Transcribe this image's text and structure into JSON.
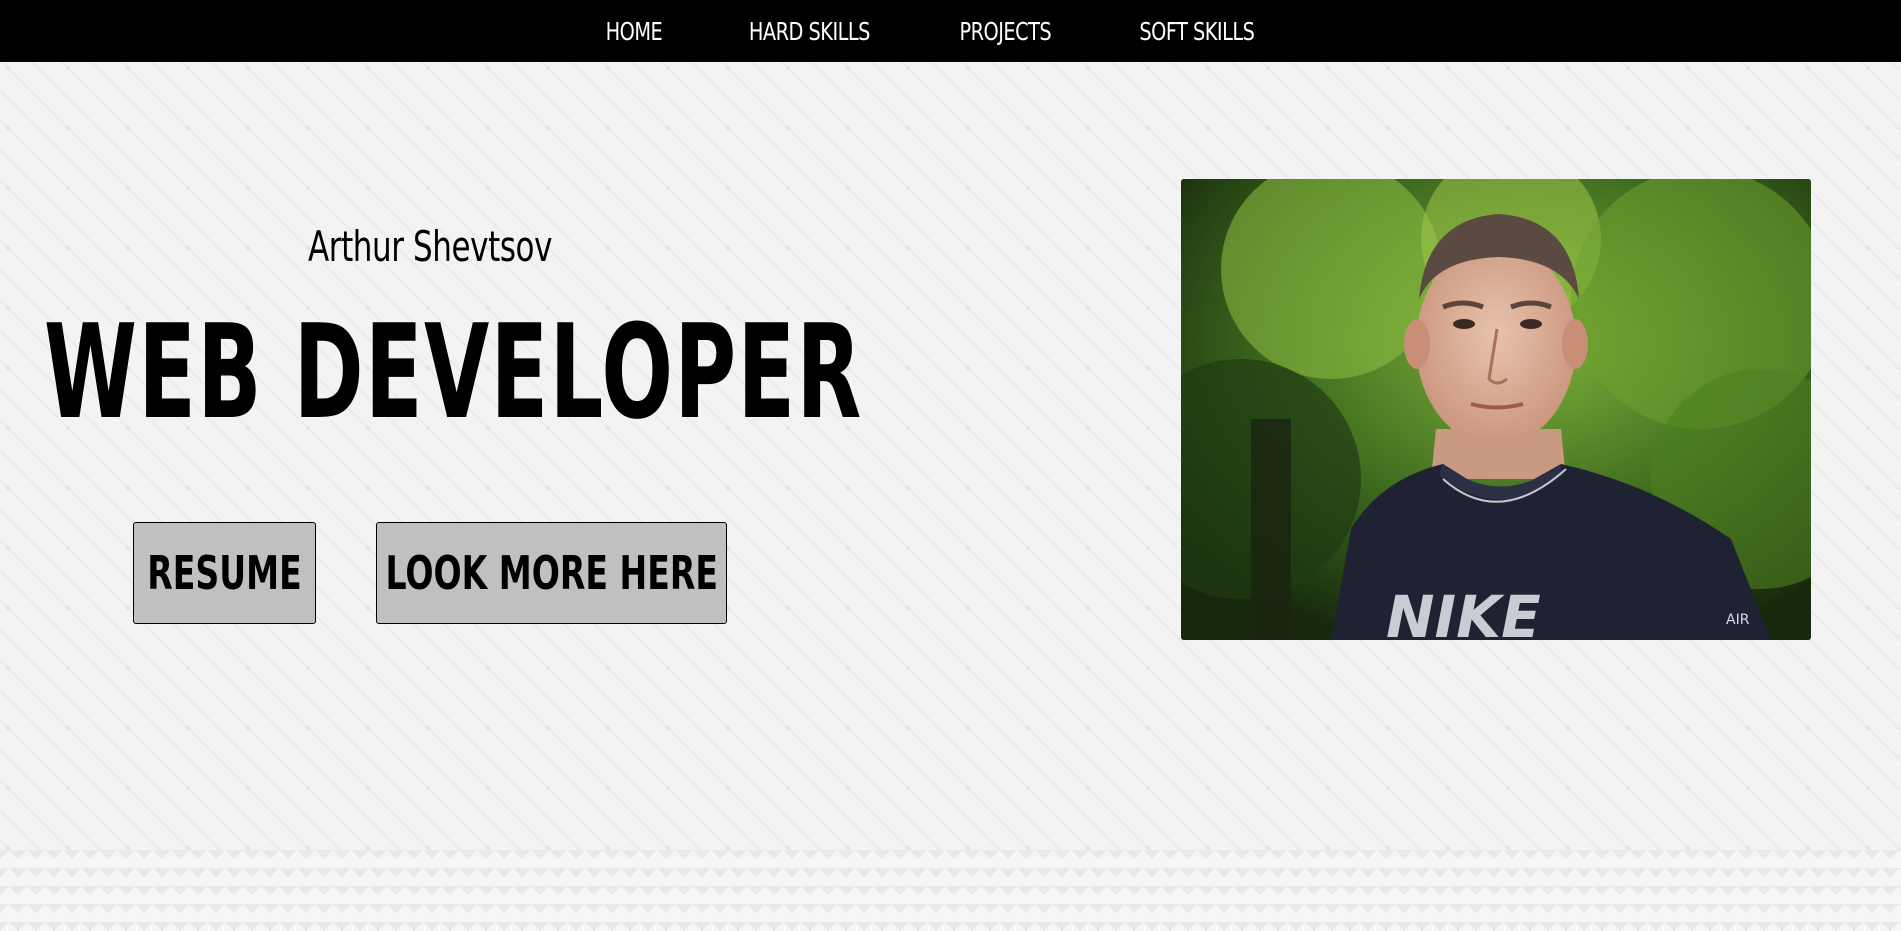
{
  "nav": {
    "items": [
      {
        "label": "HOME"
      },
      {
        "label": "HARD SKILLS"
      },
      {
        "label": "PROJECTS"
      },
      {
        "label": "SOFT SKILLS"
      }
    ]
  },
  "hero": {
    "name": "Arthur Shevtsov",
    "title": "WEB DEVELOPER",
    "buttons": {
      "resume_label": "RESUME",
      "more_label": "LOOK MORE HERE"
    },
    "photo": {
      "shirt_text": "NIKE",
      "sleeve_text": "AIR"
    }
  },
  "colors": {
    "nav_bg": "#000000",
    "nav_text": "#ffffff",
    "page_bg": "#f3f3f3",
    "button_bg": "#c0c0c0",
    "text": "#000000"
  }
}
